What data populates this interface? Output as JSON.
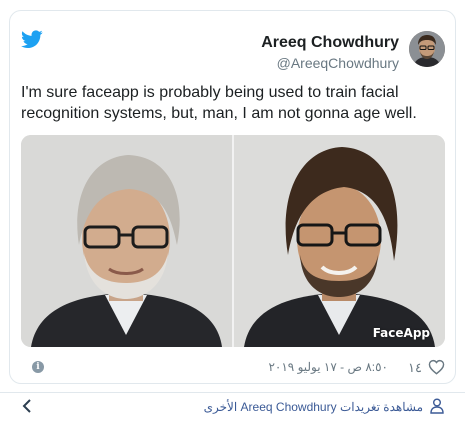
{
  "tweet": {
    "author_name": "Areeq Chowdhury",
    "author_handle": "@AreeqChowdhury",
    "text": "I'm sure faceapp is probably being used to train facial recognition systems, but, man, I am not gonna age well.",
    "media_watermark": "FaceApp",
    "like_count": "١٤",
    "timestamp": "٨:٥٠ ص - ١٧ يوليو ٢٠١٩"
  },
  "footer": {
    "more_tweets_label": "مشاهدة تغريدات Areeq Chowdhury الأخرى"
  },
  "colors": {
    "twitter_blue": "#1da1f2",
    "text_primary": "#1c2022",
    "text_secondary": "#697882",
    "link": "#3b5a96",
    "border": "#e1e8ed"
  },
  "icons": [
    "twitter-bird-icon",
    "info-icon",
    "heart-icon",
    "chevron-left-icon",
    "user-icon"
  ]
}
